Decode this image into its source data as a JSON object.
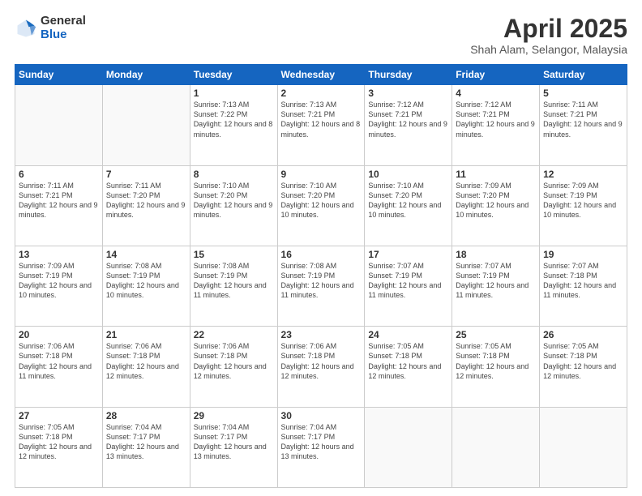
{
  "logo": {
    "general": "General",
    "blue": "Blue"
  },
  "header": {
    "title": "April 2025",
    "subtitle": "Shah Alam, Selangor, Malaysia"
  },
  "weekdays": [
    "Sunday",
    "Monday",
    "Tuesday",
    "Wednesday",
    "Thursday",
    "Friday",
    "Saturday"
  ],
  "weeks": [
    [
      {
        "day": "",
        "info": ""
      },
      {
        "day": "",
        "info": ""
      },
      {
        "day": "1",
        "info": "Sunrise: 7:13 AM\nSunset: 7:22 PM\nDaylight: 12 hours and 8 minutes."
      },
      {
        "day": "2",
        "info": "Sunrise: 7:13 AM\nSunset: 7:21 PM\nDaylight: 12 hours and 8 minutes."
      },
      {
        "day": "3",
        "info": "Sunrise: 7:12 AM\nSunset: 7:21 PM\nDaylight: 12 hours and 9 minutes."
      },
      {
        "day": "4",
        "info": "Sunrise: 7:12 AM\nSunset: 7:21 PM\nDaylight: 12 hours and 9 minutes."
      },
      {
        "day": "5",
        "info": "Sunrise: 7:11 AM\nSunset: 7:21 PM\nDaylight: 12 hours and 9 minutes."
      }
    ],
    [
      {
        "day": "6",
        "info": "Sunrise: 7:11 AM\nSunset: 7:21 PM\nDaylight: 12 hours and 9 minutes."
      },
      {
        "day": "7",
        "info": "Sunrise: 7:11 AM\nSunset: 7:20 PM\nDaylight: 12 hours and 9 minutes."
      },
      {
        "day": "8",
        "info": "Sunrise: 7:10 AM\nSunset: 7:20 PM\nDaylight: 12 hours and 9 minutes."
      },
      {
        "day": "9",
        "info": "Sunrise: 7:10 AM\nSunset: 7:20 PM\nDaylight: 12 hours and 10 minutes."
      },
      {
        "day": "10",
        "info": "Sunrise: 7:10 AM\nSunset: 7:20 PM\nDaylight: 12 hours and 10 minutes."
      },
      {
        "day": "11",
        "info": "Sunrise: 7:09 AM\nSunset: 7:20 PM\nDaylight: 12 hours and 10 minutes."
      },
      {
        "day": "12",
        "info": "Sunrise: 7:09 AM\nSunset: 7:19 PM\nDaylight: 12 hours and 10 minutes."
      }
    ],
    [
      {
        "day": "13",
        "info": "Sunrise: 7:09 AM\nSunset: 7:19 PM\nDaylight: 12 hours and 10 minutes."
      },
      {
        "day": "14",
        "info": "Sunrise: 7:08 AM\nSunset: 7:19 PM\nDaylight: 12 hours and 10 minutes."
      },
      {
        "day": "15",
        "info": "Sunrise: 7:08 AM\nSunset: 7:19 PM\nDaylight: 12 hours and 11 minutes."
      },
      {
        "day": "16",
        "info": "Sunrise: 7:08 AM\nSunset: 7:19 PM\nDaylight: 12 hours and 11 minutes."
      },
      {
        "day": "17",
        "info": "Sunrise: 7:07 AM\nSunset: 7:19 PM\nDaylight: 12 hours and 11 minutes."
      },
      {
        "day": "18",
        "info": "Sunrise: 7:07 AM\nSunset: 7:19 PM\nDaylight: 12 hours and 11 minutes."
      },
      {
        "day": "19",
        "info": "Sunrise: 7:07 AM\nSunset: 7:18 PM\nDaylight: 12 hours and 11 minutes."
      }
    ],
    [
      {
        "day": "20",
        "info": "Sunrise: 7:06 AM\nSunset: 7:18 PM\nDaylight: 12 hours and 11 minutes."
      },
      {
        "day": "21",
        "info": "Sunrise: 7:06 AM\nSunset: 7:18 PM\nDaylight: 12 hours and 12 minutes."
      },
      {
        "day": "22",
        "info": "Sunrise: 7:06 AM\nSunset: 7:18 PM\nDaylight: 12 hours and 12 minutes."
      },
      {
        "day": "23",
        "info": "Sunrise: 7:06 AM\nSunset: 7:18 PM\nDaylight: 12 hours and 12 minutes."
      },
      {
        "day": "24",
        "info": "Sunrise: 7:05 AM\nSunset: 7:18 PM\nDaylight: 12 hours and 12 minutes."
      },
      {
        "day": "25",
        "info": "Sunrise: 7:05 AM\nSunset: 7:18 PM\nDaylight: 12 hours and 12 minutes."
      },
      {
        "day": "26",
        "info": "Sunrise: 7:05 AM\nSunset: 7:18 PM\nDaylight: 12 hours and 12 minutes."
      }
    ],
    [
      {
        "day": "27",
        "info": "Sunrise: 7:05 AM\nSunset: 7:18 PM\nDaylight: 12 hours and 12 minutes."
      },
      {
        "day": "28",
        "info": "Sunrise: 7:04 AM\nSunset: 7:17 PM\nDaylight: 12 hours and 13 minutes."
      },
      {
        "day": "29",
        "info": "Sunrise: 7:04 AM\nSunset: 7:17 PM\nDaylight: 12 hours and 13 minutes."
      },
      {
        "day": "30",
        "info": "Sunrise: 7:04 AM\nSunset: 7:17 PM\nDaylight: 12 hours and 13 minutes."
      },
      {
        "day": "",
        "info": ""
      },
      {
        "day": "",
        "info": ""
      },
      {
        "day": "",
        "info": ""
      }
    ]
  ]
}
